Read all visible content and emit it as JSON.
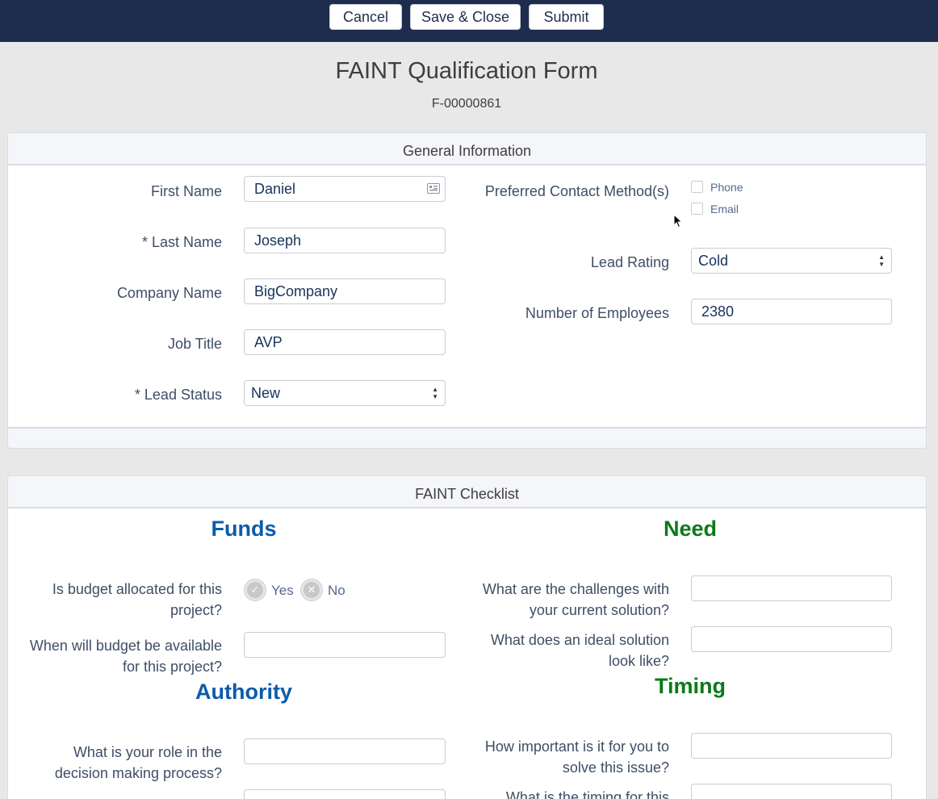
{
  "toolbar": {
    "cancel_label": "Cancel",
    "save_close_label": "Save & Close",
    "submit_label": "Submit"
  },
  "page": {
    "title": "FAINT Qualification Form",
    "record_id": "F-00000861"
  },
  "general": {
    "header": "General Information",
    "first_name": {
      "label": "First Name",
      "value": "Daniel"
    },
    "last_name": {
      "label": "* Last Name",
      "value": "Joseph"
    },
    "company_name": {
      "label": "Company Name",
      "value": "BigCompany"
    },
    "job_title": {
      "label": "Job Title",
      "value": "AVP"
    },
    "lead_status": {
      "label": "* Lead Status",
      "value": "New"
    },
    "contact_method": {
      "label": "Preferred Contact Method(s)",
      "options": [
        "Phone",
        "Email"
      ]
    },
    "lead_rating": {
      "label": "Lead Rating",
      "value": "Cold"
    },
    "employees": {
      "label": "Number of Employees",
      "value": "2380"
    }
  },
  "checklist": {
    "header": "FAINT Checklist",
    "funds": {
      "title": "Funds",
      "q1": {
        "line1": "Is budget allocated for this",
        "line2": "project?",
        "yes": "Yes",
        "no": "No"
      },
      "q2": {
        "line1": "When will budget be available",
        "line2": "for this project?"
      }
    },
    "authority": {
      "title": "Authority",
      "q1": {
        "line1": "What is your role in the",
        "line2": "decision making process?"
      }
    },
    "need": {
      "title": "Need",
      "q1": {
        "line1": "What are the challenges with",
        "line2": "your current solution?"
      },
      "q2": {
        "line1": "What does an ideal solution",
        "line2": "look like?"
      }
    },
    "timing": {
      "title": "Timing",
      "q1": {
        "line1": "How important is it for you to",
        "line2": "solve this issue?"
      },
      "q2": {
        "line1": "What is the timing for this"
      }
    }
  }
}
